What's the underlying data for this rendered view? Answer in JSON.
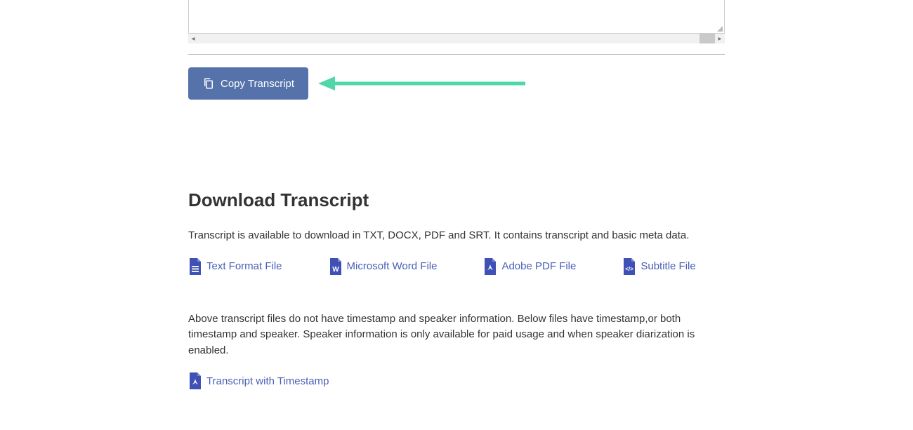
{
  "copy_button_label": "Copy Transcript",
  "heading": "Download Transcript",
  "intro_text": "Transcript is available to download in TXT, DOCX, PDF and SRT. It contains transcript and basic meta data.",
  "downloads": {
    "txt": "Text Format File",
    "docx": "Microsoft Word File",
    "pdf": "Adobe PDF File",
    "srt": "Subtitle File"
  },
  "note_text": "Above transcript files do not have timestamp and speaker information. Below files have timestamp,or both timestamp and speaker. Speaker information is only available for paid usage and when speaker diarization is enabled.",
  "timestamp_download": "Transcript with Timestamp"
}
